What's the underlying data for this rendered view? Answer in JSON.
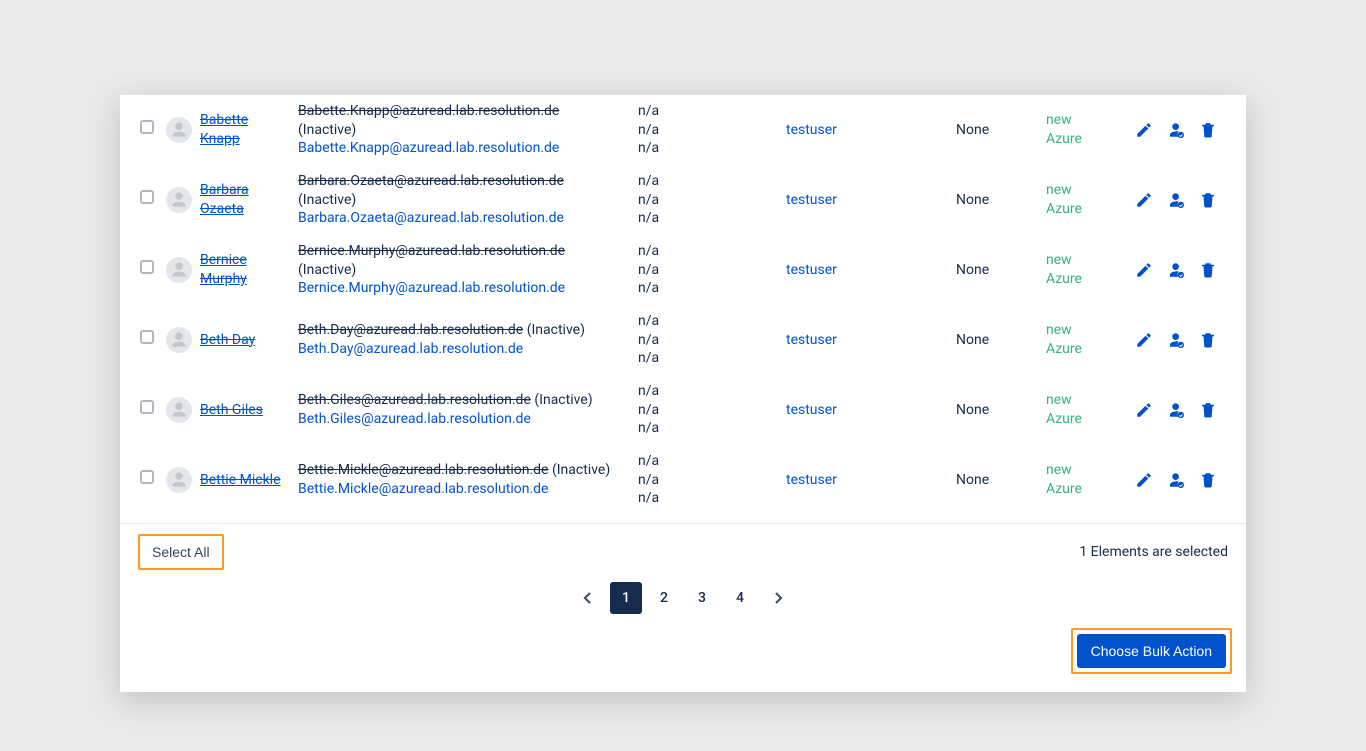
{
  "na": "n/a",
  "inactive": "(Inactive)",
  "group": "testuser",
  "none": "None",
  "new": "new",
  "azure": "Azure",
  "selectAll": "Select All",
  "selectedText": "1 Elements are selected",
  "bulkAction": "Choose Bulk Action",
  "pages": [
    "1",
    "2",
    "3",
    "4"
  ],
  "users": [
    {
      "name": "Babette Knapp",
      "oldEmail": "Babette.Knapp@azuread.lab.resolution.de",
      "newEmail": "Babette.Knapp@azuread.lab.resolution.de",
      "inline": false
    },
    {
      "name": "Barbara Ozaeta",
      "oldEmail": "Barbara.Ozaeta@azuread.lab.resolution.de",
      "newEmail": "Barbara.Ozaeta@azuread.lab.resolution.de",
      "inline": false
    },
    {
      "name": "Bernice Murphy",
      "oldEmail": "Bernice.Murphy@azuread.lab.resolution.de",
      "newEmail": "Bernice.Murphy@azuread.lab.resolution.de",
      "inline": false
    },
    {
      "name": "Beth Day",
      "oldEmail": "Beth.Day@azuread.lab.resolution.de",
      "newEmail": "Beth.Day@azuread.lab.resolution.de",
      "inline": true
    },
    {
      "name": "Beth Giles",
      "oldEmail": "Beth.Giles@azuread.lab.resolution.de",
      "newEmail": "Beth.Giles@azuread.lab.resolution.de",
      "inline": true
    },
    {
      "name": "Bettie Mickle",
      "oldEmail": "Bettie.Mickle@azuread.lab.resolution.de",
      "newEmail": "Bettie.Mickle@azuread.lab.resolution.de",
      "inline": true
    }
  ]
}
